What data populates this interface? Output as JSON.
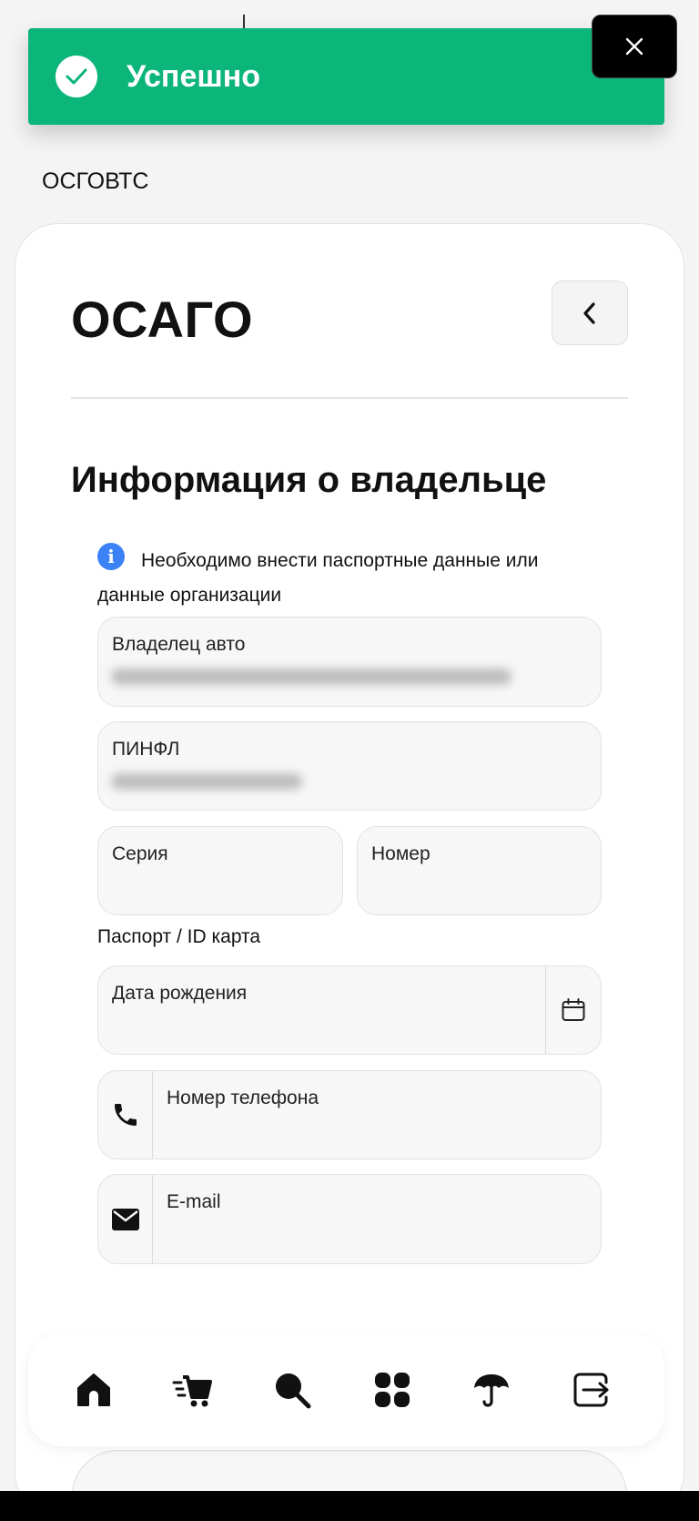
{
  "toast": {
    "message": "Успешно",
    "color": "#0cb579"
  },
  "section_label": "ОСГОВТС",
  "header": {
    "title": "ОСАГО"
  },
  "section": {
    "title": "Информация о владельце",
    "info_text": "Необходимо внести паспортные данные или данные организации"
  },
  "fields": {
    "owner": {
      "label": "Владелец авто"
    },
    "pinfl": {
      "label": "ПИНФЛ"
    },
    "series": {
      "label": "Серия"
    },
    "number": {
      "label": "Номер"
    },
    "passport_caption": "Паспорт / ID карта",
    "birth_date": {
      "label": "Дата рождения"
    },
    "phone": {
      "label": "Номер телефона"
    },
    "email": {
      "label": "E-mail"
    }
  },
  "nav": {
    "items": [
      "home-icon",
      "cart-icon",
      "search-icon",
      "apps-icon",
      "umbrella-icon",
      "logout-icon"
    ]
  },
  "colors": {
    "accent": "#0cb579",
    "info": "#3b82f6"
  }
}
